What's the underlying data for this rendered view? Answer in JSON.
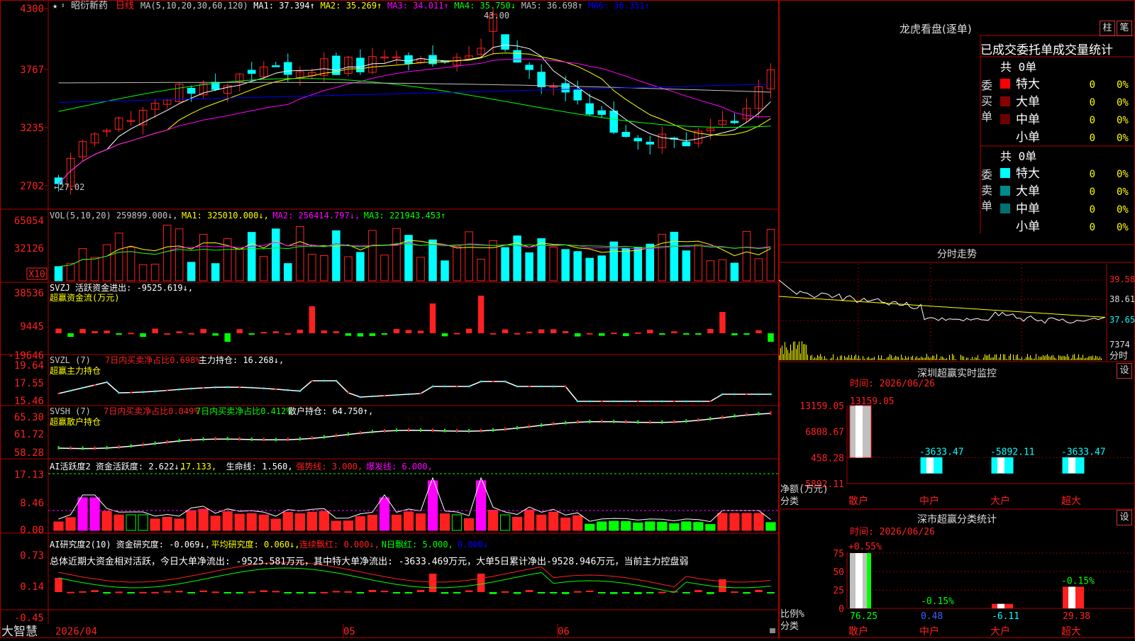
{
  "app": {
    "brand": "大智慧",
    "stock_name": "昭衍新药",
    "period": "日线",
    "lock_icon": "lock-icon"
  },
  "colors": {
    "up": "#ff2020",
    "down": "#00ffff",
    "ma1": "#ffffff",
    "ma2": "#ffff00",
    "ma3": "#ff00ff",
    "ma4": "#00ff00",
    "ma5": "#c0c0c0",
    "ma6": "#0000ff",
    "grid": "#8b0000"
  },
  "price_panel": {
    "legend": [
      {
        "t": "MA(5,10,20,30,60,120)",
        "c": "#c8c8c8"
      },
      {
        "t": "MA1: 37.394↑",
        "c": "#ffffff"
      },
      {
        "t": "MA2: 35.269↑",
        "c": "#ffff00"
      },
      {
        "t": "MA3: 34.011↑",
        "c": "#ff00ff"
      },
      {
        "t": "MA4: 35.750↓",
        "c": "#00ff00"
      },
      {
        "t": "MA5: 36.698↑",
        "c": "#c0c0c0"
      },
      {
        "t": "MA6: 36.351↑",
        "c": "#0000ff"
      }
    ],
    "y_labels": [
      "4300",
      "3767",
      "3235",
      "2702"
    ],
    "high_label": "43.00",
    "low_label": "←27.02"
  },
  "vol_panel": {
    "legend": [
      {
        "t": "VOL(5,10,20) 259899.000↓,",
        "c": "#c8c8c8"
      },
      {
        "t": "MA1: 325010.000↓,",
        "c": "#ffff00"
      },
      {
        "t": "MA2: 256414.797↓,",
        "c": "#ff00ff"
      },
      {
        "t": "MA3: 221943.453↑",
        "c": "#00ff00"
      }
    ],
    "y_labels": [
      "65054",
      "32126"
    ],
    "unit": "X10"
  },
  "svzj_panel": {
    "line1": "SVZJ  活跃资金进出: -9525.619↓,",
    "line2": "超赢资金流(万元)",
    "y_labels": [
      "38536",
      "9445",
      "-19646"
    ]
  },
  "svzl_panel": {
    "legend": [
      {
        "t": "SVZL (7)",
        "c": "#c8c8c8"
      },
      {
        "t": "7日内买卖净占比0.698%",
        "c": "#ff2020"
      },
      {
        "t": "主力持仓: 16.268↓,",
        "c": "#ffffff"
      }
    ],
    "line2": "超赢主力持仓",
    "y_labels": [
      "19.64",
      "17.55",
      "15.46"
    ]
  },
  "svsh_panel": {
    "legend": [
      {
        "t": "SVSH (7)",
        "c": "#c8c8c8"
      },
      {
        "t": "7日内买卖净占比0.049%",
        "c": "#ff2020"
      },
      {
        "t": "7日内买卖净占比0.412%",
        "c": "#00ff00"
      },
      {
        "t": "散户持仓: 64.750↑,",
        "c": "#ffffff"
      }
    ],
    "line2": "超赢散户持仓",
    "y_labels": [
      "65.30",
      "61.72",
      "58.28"
    ]
  },
  "ai_active_panel": {
    "legend": [
      {
        "t": "AI活跃度2 资金活跃度: 2.622↓,",
        "c": "#ffffff"
      },
      {
        "t": "17.133,",
        "c": "#ffff00"
      },
      {
        "t": "生命线: 1.560,",
        "c": "#ffffff"
      },
      {
        "t": "强势线: 3.000,",
        "c": "#ff2020"
      },
      {
        "t": "爆发线: 6.000,",
        "c": "#ff00ff"
      }
    ],
    "y_labels": [
      "17.13",
      "8.46",
      "0.00"
    ]
  },
  "ai_research_panel": {
    "legend": [
      {
        "t": "AI研究度2(10) 资金研究度: -0.069↓,",
        "c": "#ffffff"
      },
      {
        "t": "平均研究度: 0.060↓,",
        "c": "#ffff00"
      },
      {
        "t": "连续飘红: 0.000↓,",
        "c": "#ff2020"
      },
      {
        "t": "N日飘红: 5.000,",
        "c": "#00ff00"
      },
      {
        "t": "0.000↓",
        "c": "#0000ff"
      }
    ],
    "summary": "总体近期大资金相对活跃，今日大单净流出: -9525.581万元，其中特大单净流出: -3633.469万元，大单5日累计净出-9528.946万元，当前主力控盘弱",
    "y_labels": [
      "0.73",
      "0.14",
      "-0.45"
    ]
  },
  "time_axis": {
    "labels": [
      "2026/04",
      "05",
      "06"
    ]
  },
  "right": {
    "dragon_title": "龙虎看盘(逐单)",
    "tab_bar": "柱",
    "tab_brush": "笔",
    "order_tabs": [
      "已成交",
      "委托单",
      "成交量",
      "统计"
    ],
    "buy_block": {
      "side_label": "委买单",
      "total": "共 0单",
      "rows": [
        {
          "name": "特大",
          "count": "0",
          "pct": "0%"
        },
        {
          "name": "大单",
          "count": "0",
          "pct": "0%"
        },
        {
          "name": "中单",
          "count": "0",
          "pct": "0%"
        },
        {
          "name": "小单",
          "count": "0",
          "pct": "0%"
        }
      ]
    },
    "sell_block": {
      "side_label": "委卖单",
      "total": "共 0单",
      "rows": [
        {
          "name": "特大",
          "count": "0",
          "pct": "0%"
        },
        {
          "name": "大单",
          "count": "0",
          "pct": "0%"
        },
        {
          "name": "中单",
          "count": "0",
          "pct": "0%"
        },
        {
          "name": "小单",
          "count": "0",
          "pct": "0%"
        }
      ]
    },
    "intraday": {
      "title": "分时走势",
      "price_labels": [
        "39.58",
        "38.61",
        "37.65"
      ],
      "vol_label": "7374",
      "x_label": "分时"
    },
    "monitor": {
      "title": "深圳超赢实时监控",
      "settings": "设",
      "time": "时间: 2026/06/26",
      "y_labels": [
        "13159.05",
        "6808.67",
        "458.28",
        "-5892.11"
      ],
      "y_title": "净额(万元)",
      "x_title": "分类",
      "categories": [
        "散户",
        "中户",
        "大户",
        "超大"
      ],
      "values": [
        13159.05,
        -3633.47,
        -5892.11,
        -3633.47
      ],
      "value_labels": [
        "13159.05",
        "-3633.47",
        "-5892.11",
        "-3633.47"
      ]
    },
    "stats": {
      "title": "深市超赢分类统计",
      "settings": "设",
      "time": "时间: 2026/06/26",
      "y_labels": [
        "75",
        "50",
        "25",
        "0"
      ],
      "y_title": "比例%",
      "x_title": "分类",
      "categories": [
        "散户",
        "中户",
        "大户",
        "超大"
      ],
      "bottom_values": [
        "76.25",
        "0.48",
        "-6.11",
        "29.38"
      ],
      "top_labels": [
        "+0.55%",
        "-0.15%",
        "",
        "-0.15%"
      ]
    }
  }
}
